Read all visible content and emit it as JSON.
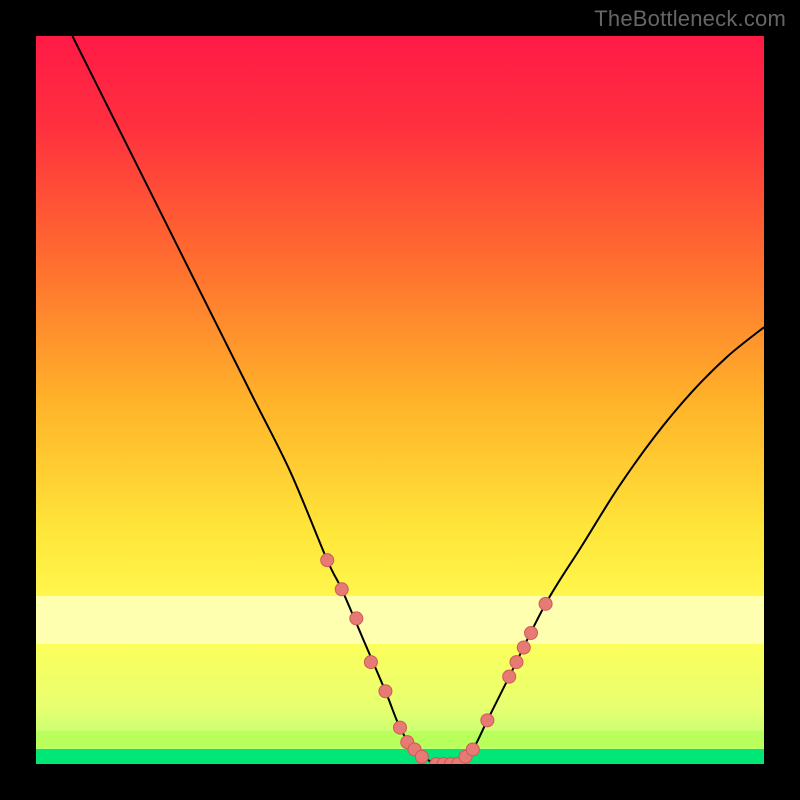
{
  "attribution": "TheBottleneck.com",
  "colors": {
    "frame": "#000000",
    "gradient_top": "#ff173f",
    "gradient_mid1": "#ff7a2b",
    "gradient_mid2": "#ffd23a",
    "gradient_mid3": "#ffff55",
    "gradient_bottom": "#d8ff7a",
    "band_pale": "#ffffb0",
    "band_lime": "#b6ff58",
    "band_green": "#00e676",
    "curve": "#000000",
    "dot_fill": "#e77a74",
    "dot_stroke": "#cc5a57"
  },
  "chart_data": {
    "type": "line",
    "title": "",
    "xlabel": "",
    "ylabel": "",
    "xlim": [
      0,
      100
    ],
    "ylim": [
      0,
      100
    ],
    "series": [
      {
        "name": "bottleneck-curve",
        "x": [
          5,
          10,
          15,
          20,
          25,
          30,
          35,
          40,
          42,
          45,
          48,
          50,
          52,
          55,
          58,
          60,
          62,
          65,
          70,
          75,
          80,
          85,
          90,
          95,
          100
        ],
        "y": [
          100,
          90,
          80,
          70,
          60,
          50,
          40,
          28,
          24,
          17,
          10,
          5,
          2,
          0,
          0,
          2,
          6,
          12,
          22,
          30,
          38,
          45,
          51,
          56,
          60
        ]
      }
    ],
    "highlight_points": {
      "name": "marked-dots",
      "x": [
        40,
        42,
        44,
        46,
        48,
        50,
        51,
        52,
        53,
        55,
        56,
        57,
        58,
        59,
        60,
        62,
        65,
        66,
        67,
        68,
        70
      ],
      "y": [
        28,
        24,
        20,
        14,
        10,
        5,
        3,
        2,
        1,
        0,
        0,
        0,
        0,
        1,
        2,
        6,
        12,
        14,
        16,
        18,
        22
      ]
    },
    "bands": [
      {
        "name": "pale-yellow-band",
        "y_from": 17,
        "y_to": 23
      },
      {
        "name": "lime-band",
        "y_from": 3,
        "y_to": 5
      },
      {
        "name": "green-band",
        "y_from": 0,
        "y_to": 2
      }
    ]
  }
}
